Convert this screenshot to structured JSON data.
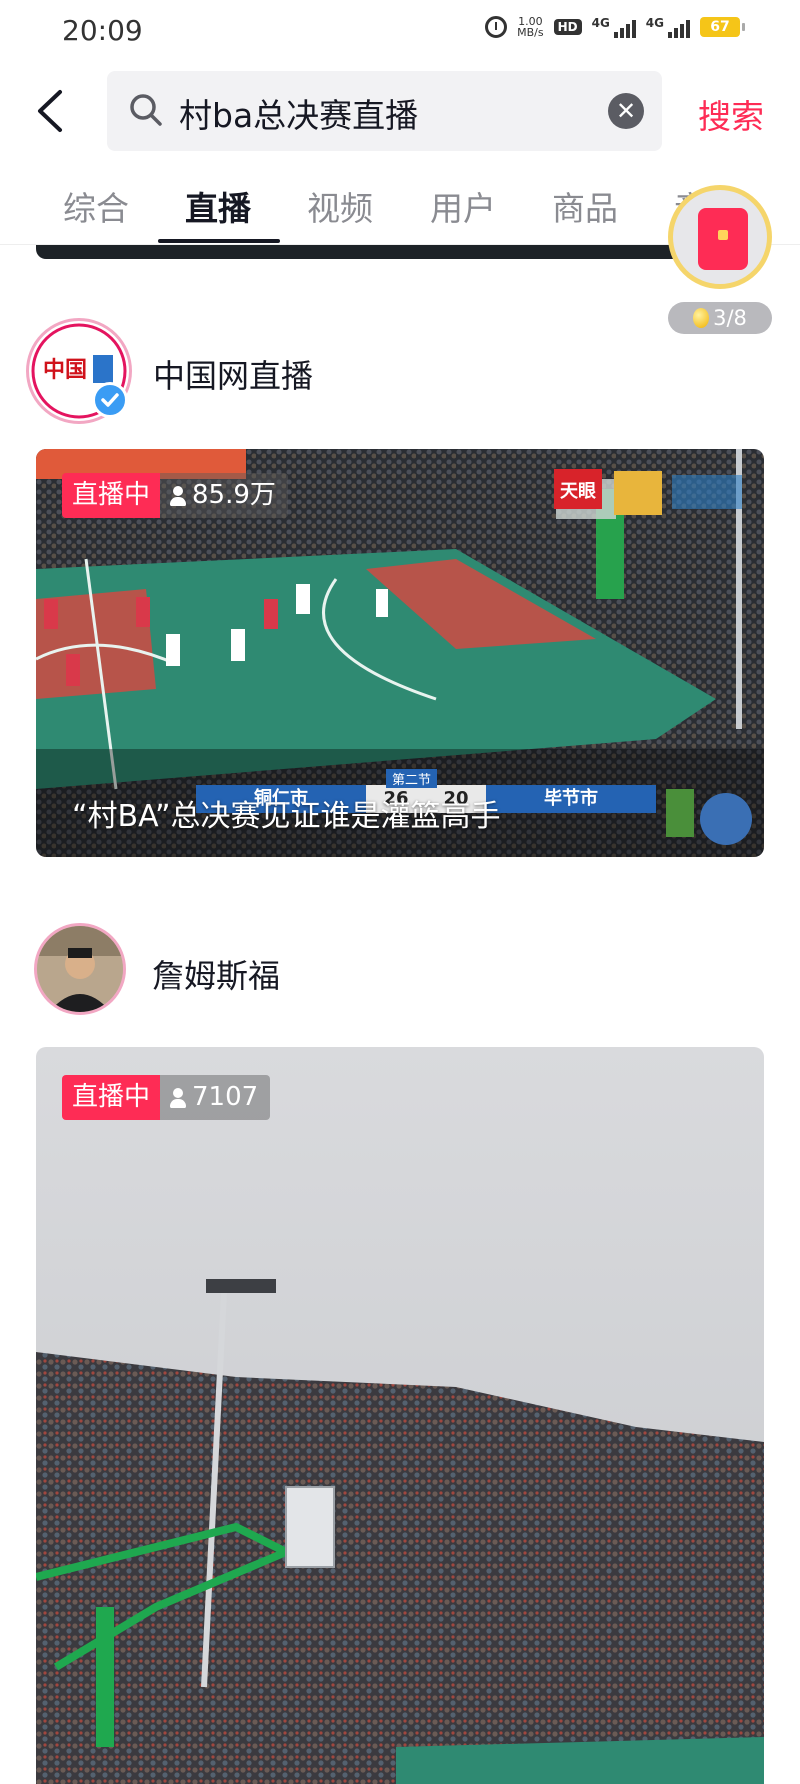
{
  "status_bar": {
    "time": "20:09",
    "network_speed": "1.00",
    "network_unit": "MB/s",
    "hd_label": "HD",
    "signal1": "4G",
    "signal2": "4G",
    "battery": "67"
  },
  "search": {
    "query": "村ba总决赛直播",
    "submit_label": "搜索"
  },
  "tabs": [
    {
      "label": "综合"
    },
    {
      "label": "直播",
      "active": true
    },
    {
      "label": "视频"
    },
    {
      "label": "用户"
    },
    {
      "label": "商品"
    },
    {
      "label": "音乐"
    }
  ],
  "reward": {
    "progress": "3/8"
  },
  "results": [
    {
      "anchor_name": "中国网直播",
      "live_label": "直播中",
      "viewers": "85.9万",
      "title": "“村BA”总决赛见证谁是灌篮高手",
      "verified": true,
      "scoreboard": {
        "team_left": "铜仁市",
        "score_left": "26",
        "score_right": "20",
        "team_right": "毕节市",
        "period": "第二节"
      },
      "sponsor_logo": "天眼"
    },
    {
      "anchor_name": "詹姆斯福",
      "live_label": "直播中",
      "viewers": "7107",
      "title": ""
    }
  ],
  "colors": {
    "accent": "#fe2c55",
    "text_primary": "#161823",
    "text_secondary": "#8a8b91",
    "court_green": "#2f8a72",
    "court_red": "#b7544a"
  }
}
